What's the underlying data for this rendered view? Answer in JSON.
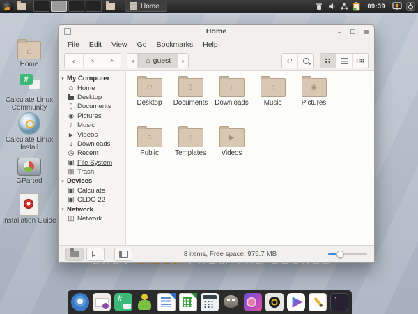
{
  "top_panel": {
    "start_icons": [
      "calculate-menu-icon",
      "home-folder-icon"
    ],
    "workspaces": [
      {
        "state": ""
      },
      {
        "state": "active"
      },
      {
        "state": ""
      },
      {
        "state": ""
      }
    ],
    "desktop_show_icon": "desktop-folder-icon",
    "taskbar": {
      "icon": "file-manager-icon",
      "label": "Home"
    },
    "tray_icons": [
      "trash-icon",
      "volume-icon",
      "network-icon",
      "clipboard-icon"
    ],
    "clock": "09:39",
    "session_icons": [
      "session-indicator-icon",
      "logout-icon"
    ]
  },
  "desktop": {
    "icons": [
      {
        "name": "home",
        "label": "Home"
      },
      {
        "name": "community",
        "label": "Calculate Linux Community"
      },
      {
        "name": "install",
        "label": "Calculate Linux Install"
      },
      {
        "name": "gparted",
        "label": "GParted"
      },
      {
        "name": "guide",
        "label": "Installation Guide"
      }
    ],
    "slogan": {
      "pre": "EASY ",
      "accent": "LINUX",
      "post": " FROM THE SOURCE",
      "accent_color": "#e2930f"
    }
  },
  "window": {
    "title": "Home",
    "menus": [
      "File",
      "Edit",
      "View",
      "Go",
      "Bookmarks",
      "Help"
    ],
    "toolbar": {
      "nav_icons": [
        "back-icon",
        "forward-icon",
        "up-icon"
      ],
      "location": "guest",
      "right_icons": [
        "location-entry-icon",
        "search-icon",
        "grid-view-icon",
        "list-view-icon",
        "compact-view-icon"
      ],
      "active_view": "grid"
    },
    "sidebar": [
      {
        "type": "header",
        "label": "My Computer"
      },
      {
        "type": "item",
        "icon": "home-icon",
        "label": "Home"
      },
      {
        "type": "item",
        "icon": "folder-icon",
        "label": "Desktop"
      },
      {
        "type": "item",
        "icon": "doc-icon",
        "label": "Documents"
      },
      {
        "type": "item",
        "icon": "camera-icon",
        "label": "Pictures"
      },
      {
        "type": "item",
        "icon": "music-icon",
        "label": "Music"
      },
      {
        "type": "item",
        "icon": "video-icon",
        "label": "Videos"
      },
      {
        "type": "item",
        "icon": "download-icon",
        "label": "Downloads"
      },
      {
        "type": "item",
        "icon": "recent-icon",
        "label": "Recent"
      },
      {
        "type": "item",
        "icon": "drive-icon",
        "label": "File System",
        "state": "focused"
      },
      {
        "type": "item",
        "icon": "trash-icon",
        "label": "Trash"
      },
      {
        "type": "header",
        "label": "Devices"
      },
      {
        "type": "item",
        "icon": "drive-icon",
        "label": "Calculate"
      },
      {
        "type": "item",
        "icon": "drive-icon",
        "label": "CLDC-22"
      },
      {
        "type": "header",
        "label": "Network"
      },
      {
        "type": "item",
        "icon": "network-icon",
        "label": "Network"
      }
    ],
    "folders": [
      {
        "label": "Desktop",
        "emblem": "□"
      },
      {
        "label": "Documents",
        "emblem": "▯"
      },
      {
        "label": "Downloads",
        "emblem": "↓"
      },
      {
        "label": "Music",
        "emblem": "♫"
      },
      {
        "label": "Pictures",
        "emblem": "◉"
      },
      {
        "label": "Templates",
        "emblem": "▯"
      },
      {
        "label": "Videos",
        "emblem": "▶"
      }
    ],
    "folders_row1_extra": {
      "label": "Public",
      "emblem": "∴"
    },
    "statusbar": {
      "text": "8 items, Free space: 975.7 MB",
      "buttons": [
        "places-toggle-icon",
        "tree-toggle-icon",
        "panel-toggle-icon"
      ],
      "zoom_accent": "#4a86d8"
    }
  },
  "dock": {
    "items": [
      {
        "name": "chromium-icon"
      },
      {
        "name": "mail-icon"
      },
      {
        "name": "chat-icon"
      },
      {
        "name": "user-icon"
      },
      {
        "name": "writer-icon"
      },
      {
        "name": "spreadsheet-icon"
      },
      {
        "name": "calculator-icon"
      },
      {
        "name": "gimp-icon"
      },
      {
        "name": "screenshot-icon"
      },
      {
        "name": "speaker-icon"
      },
      {
        "name": "media-player-icon"
      },
      {
        "name": "text-editor-icon"
      },
      {
        "name": "terminal-icon"
      }
    ]
  }
}
